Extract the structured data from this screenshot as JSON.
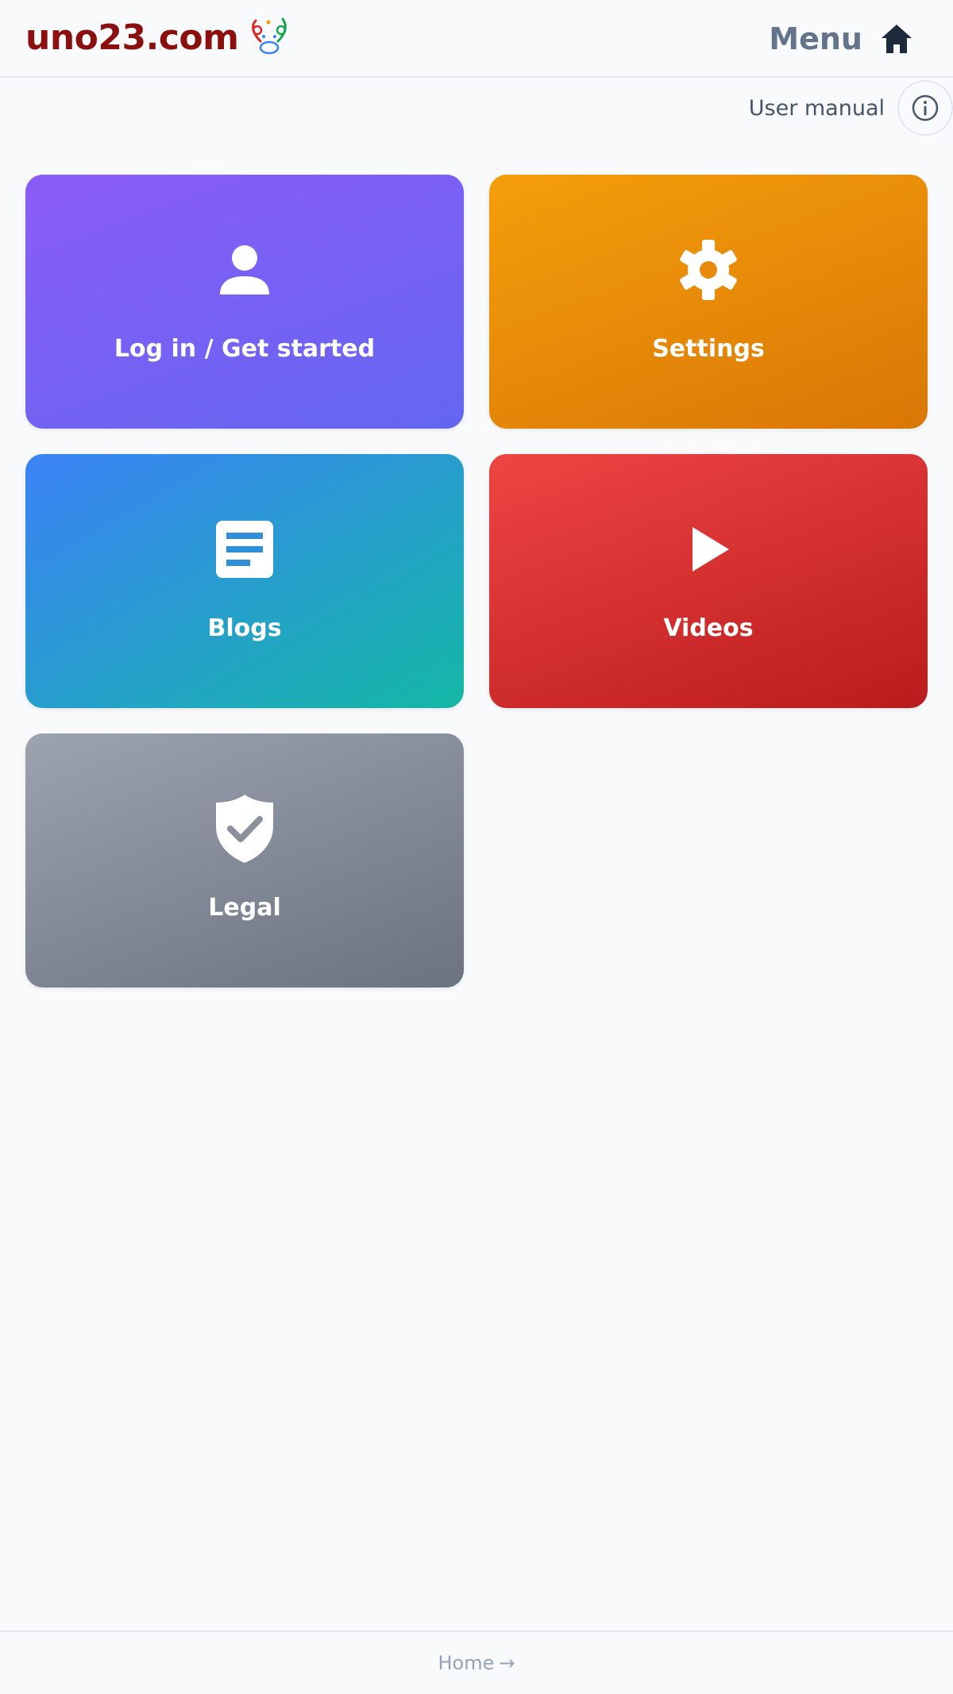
{
  "header": {
    "brand": "uno23.com",
    "menu_label": "Menu",
    "brand_color": "#8b0f0f",
    "menu_icon": "home-icon",
    "logo_icon": "uno23-logo"
  },
  "user_manual": {
    "label": "User manual",
    "icon": "info-icon"
  },
  "tiles": [
    {
      "label": "Log in / Get started",
      "icon": "user-icon",
      "colors": [
        "#8b5cf6",
        "#6366f1"
      ]
    },
    {
      "label": "Settings",
      "icon": "gear-icon",
      "colors": [
        "#f59e0b",
        "#d97706"
      ]
    },
    {
      "label": "Blogs",
      "icon": "document-icon",
      "colors": [
        "#3b82f6",
        "#14b8a6"
      ]
    },
    {
      "label": "Videos",
      "icon": "play-icon",
      "colors": [
        "#ef4444",
        "#b91c1c"
      ]
    },
    {
      "label": "Legal",
      "icon": "shield-check-icon",
      "colors": [
        "#9ca3af",
        "#6b7280"
      ]
    }
  ],
  "footer": {
    "link_label": "Home",
    "link_arrow": "→"
  }
}
